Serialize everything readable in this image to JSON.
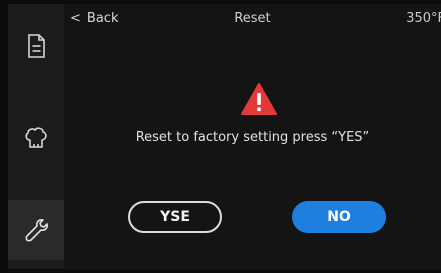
{
  "header": {
    "back_label": "Back",
    "back_chevron": "<",
    "title": "Reset",
    "temperature": "350°F"
  },
  "sidebar": {
    "items": [
      {
        "icon": "document-icon",
        "active": false
      },
      {
        "icon": "chef-hat-icon",
        "active": false
      },
      {
        "icon": "wrench-icon",
        "active": true
      }
    ]
  },
  "dialog": {
    "icon": "warning-icon",
    "message": "Reset to factory setting press “YES”",
    "yes_label": "YSE",
    "no_label": "NO"
  },
  "colors": {
    "warning": "#e23a3a",
    "primary_button": "#1e7fe0",
    "background": "#141414",
    "sidebar": "#1c1c1c"
  }
}
